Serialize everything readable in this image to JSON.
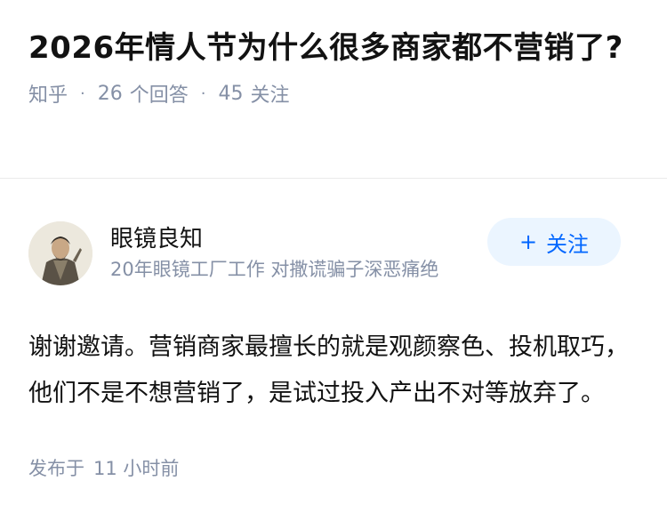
{
  "question": {
    "title": "2026年情人节为什么很多商家都不营销了?",
    "source": "知乎",
    "answer_count": "26",
    "answer_label": "个回答",
    "follower_count": "45",
    "follower_label": "关注",
    "separator": "·"
  },
  "author": {
    "name": "眼镜良知",
    "bio": "20年眼镜工厂工作 对撒谎骗子深恶痛绝",
    "follow_button": "关注",
    "follow_icon": "plus-icon"
  },
  "answer": {
    "text": "谢谢邀请。营销商家最擅长的就是观颜察色、投机取巧，他们不是不想营销了，是试过投入产出不对等放弃了。"
  },
  "footer": {
    "published_label": "发布于",
    "published_time": "11 小时前"
  },
  "colors": {
    "accent": "#0066ff",
    "accent_bg": "#ebf5ff",
    "meta_gray": "#8590a6"
  }
}
